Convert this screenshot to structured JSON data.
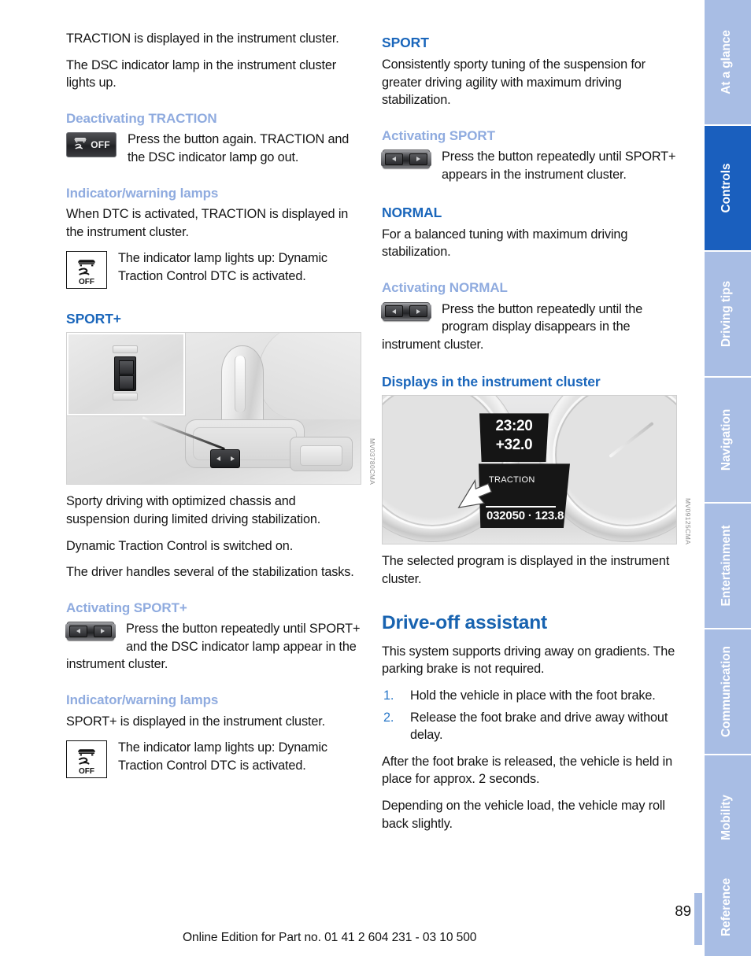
{
  "document": {
    "page_number": "89",
    "footer": "Online Edition for Part no. 01 41 2 604 231 - 03 10 500"
  },
  "left_column": {
    "intro_paragraph_1": "TRACTION is displayed in the instrument cluster.",
    "intro_paragraph_2": "The DSC indicator lamp in the instrument cluster lights up.",
    "deactivating_traction": {
      "heading": "Deactivating TRACTION",
      "button_label": "OFF",
      "text": "Press the button again. TRACTION and the DSC indicator lamp go out."
    },
    "indicator_lamps_1": {
      "heading": "Indicator/warning lamps",
      "paragraph": "When DTC is activated, TRACTION is displayed in the instrument cluster.",
      "lamp_label": "OFF",
      "lamp_text": "The indicator lamp lights up: Dynamic Traction Control DTC is activated."
    },
    "sport_plus": {
      "heading": "SPORT+",
      "figure_code": "MV03780CMA",
      "paragraph_1": "Sporty driving with optimized chassis and suspension during limited driving stabilization.",
      "paragraph_2": "Dynamic Traction Control is switched on.",
      "paragraph_3": "The driver handles several of the stabilization tasks."
    },
    "activating_sport_plus": {
      "heading": "Activating SPORT+",
      "text": "Press the button repeatedly until SPORT+ and the DSC indicator lamp appear in the instrument cluster."
    },
    "indicator_lamps_2": {
      "heading": "Indicator/warning lamps",
      "paragraph": "SPORT+ is displayed in the instrument cluster.",
      "lamp_label": "OFF",
      "lamp_text": "The indicator lamp lights up: Dynamic Traction Control DTC is activated."
    }
  },
  "right_column": {
    "sport": {
      "heading": "SPORT",
      "paragraph": "Consistently sporty tuning of the suspension for greater driving agility with maximum driving stabilization."
    },
    "activating_sport": {
      "heading": "Activating SPORT",
      "text": "Press the button repeatedly until SPORT+ appears in the instrument cluster."
    },
    "normal": {
      "heading": "NORMAL",
      "paragraph": "For a balanced tuning with maximum driving stabilization."
    },
    "activating_normal": {
      "heading": "Activating NORMAL",
      "text": "Press the button repeatedly until the program display disappears in the instrument cluster."
    },
    "displays": {
      "heading": "Displays in the instrument cluster",
      "figure_code": "MV09125CMA",
      "caption": "The selected program is displayed in the instrument cluster."
    },
    "drive_off_assistant": {
      "heading": "Drive-off assistant",
      "paragraph_1": "This system supports driving away on gradients. The parking brake is not required.",
      "steps": [
        {
          "number": "1.",
          "text": "Hold the vehicle in place with the foot brake."
        },
        {
          "number": "2.",
          "text": "Release the foot brake and drive away without delay."
        }
      ],
      "paragraph_2": "After the foot brake is released, the vehicle is held in place for approx. 2 seconds.",
      "paragraph_3": "Depending on the vehicle load, the vehicle may roll back slightly."
    }
  },
  "cluster_display": {
    "time": "23:20",
    "temperature": "+32.0",
    "program": "TRACTION",
    "odometer": "032050 · 123.8"
  },
  "side_tabs": [
    {
      "label": "At a glance",
      "active": false
    },
    {
      "label": "Controls",
      "active": true
    },
    {
      "label": "Driving tips",
      "active": false
    },
    {
      "label": "Navigation",
      "active": false
    },
    {
      "label": "Entertainment",
      "active": false
    },
    {
      "label": "Communication",
      "active": false
    },
    {
      "label": "Mobility",
      "active": false
    },
    {
      "label": "Reference",
      "active": false
    }
  ],
  "colors": {
    "heading_primary": "#1863b0",
    "heading_secondary": "#1a66bb",
    "heading_tertiary": "#8fabdf",
    "tab_inactive": "#a8bde4",
    "tab_active": "#1a5fbe",
    "list_number": "#2b79c9"
  }
}
